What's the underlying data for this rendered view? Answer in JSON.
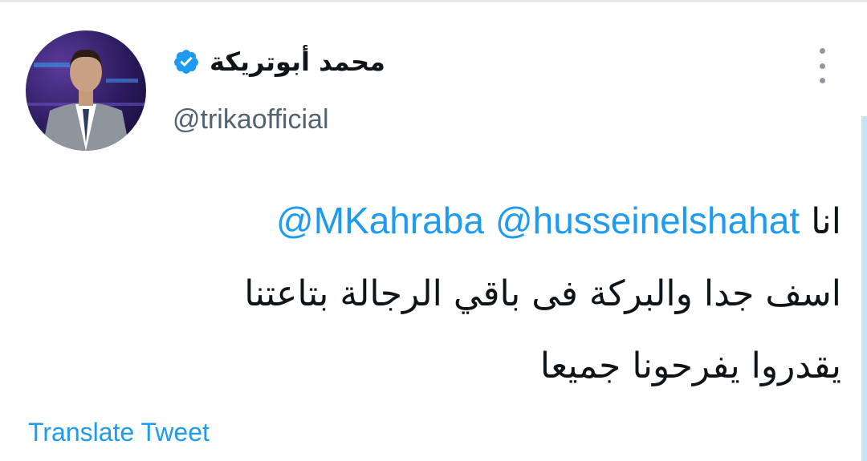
{
  "author": {
    "display_name": "محمد أبوتريكة",
    "handle": "@trikaofficial",
    "verified_icon": "verified-badge-icon",
    "avatar_icon": "profile-photo"
  },
  "menu": {
    "icon": "more-vertical-icon"
  },
  "tweet": {
    "lead": "انا",
    "mentions": [
      "@husseinelshahat",
      "@MKahraba"
    ],
    "line2": "اسف جدا والبركة فى باقي الرجالة بتاعتنا",
    "line3": "يقدروا يفرحونا جميعا"
  },
  "actions": {
    "translate_label": "Translate Tweet"
  },
  "colors": {
    "link": "#1d9bf0",
    "secondary_text": "#536471",
    "verified": "#1d9bf0"
  }
}
